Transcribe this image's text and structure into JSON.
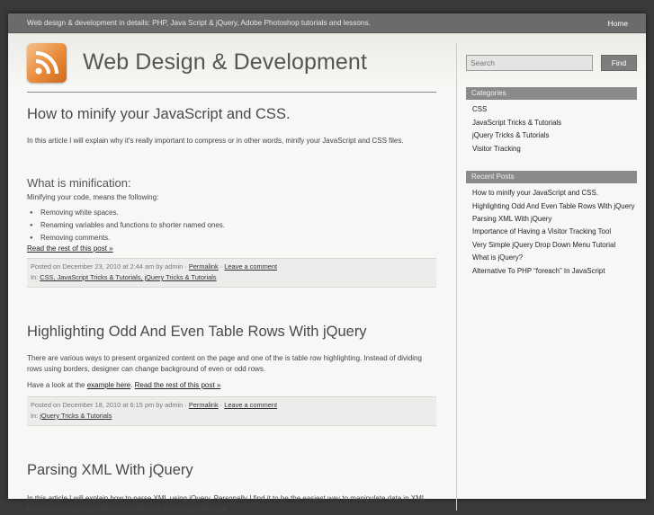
{
  "topbar": {
    "tagline": "Web design & development in details: PHP, Java Script & jQuery, Adobe Photoshop tutorials and lessons.",
    "home": "Home"
  },
  "site": {
    "title": "Web Design & Development",
    "logo_icon": "rss-feed-icon"
  },
  "posts": [
    {
      "title": "How to minify your JavaScript and CSS.",
      "intro": "In this article I will explain why it's really important to compress or in other words, minify your JavaScript and CSS files.",
      "subhead": "What is minification:",
      "subintro": "Minifying your code, means the following:",
      "bullets": [
        "Removing white spaces.",
        "Renaming variables and functions to shorter named ones.",
        "Removing comments."
      ],
      "more": "Read the rest of this post »",
      "meta_posted": "Posted on December 23, 2010 at 2:44 am by admin",
      "permalink": "Permalink",
      "comment": "Leave a comment",
      "in_label": "In:",
      "cats": "CSS, JavaScript Tricks & Tutorials, jQuery Tricks & Tutorials"
    },
    {
      "title": "Highlighting Odd And Even Table Rows With jQuery",
      "intro": "There are various ways to present organized content on the page and one of the is table row highlighting. Instead of dividing rows using borders, designer can change background of even or odd rows.",
      "look": "Have a look at the",
      "example": "example here",
      "more": "Read the rest of this post »",
      "meta_posted": "Posted on December 18, 2010 at 6:15 pm by admin",
      "permalink": "Permalink",
      "comment": "Leave a comment",
      "in_label": "In:",
      "cats": "jQuery Tricks & Tutorials"
    },
    {
      "title": "Parsing XML With jQuery",
      "intro": "In this article I will explain how to parse XML using jQuery. Personally I find it to be the easiest way to manipulate data in XML format since jQuery provides very intuitive and simple interface."
    }
  ],
  "sidebar": {
    "search_placeholder": "Search",
    "find": "Find",
    "categories_title": "Categories",
    "categories": [
      "CSS",
      "JavaScript Tricks & Tutorials",
      "jQuery Tricks & Tutorials",
      "Visitor Tracking"
    ],
    "recent_title": "Recent Posts",
    "recent": [
      "How to minify your JavaScript and CSS.",
      "Highlighting Odd And Even Table Rows With jQuery",
      "Parsing XML With jQuery",
      "Importance of Having a Visitor Tracking Tool",
      "Very Simple jQuery Drop Down Menu Tutorial",
      "What is jQuery?",
      "Alternative To PHP “foreach” In JavaScript"
    ]
  }
}
